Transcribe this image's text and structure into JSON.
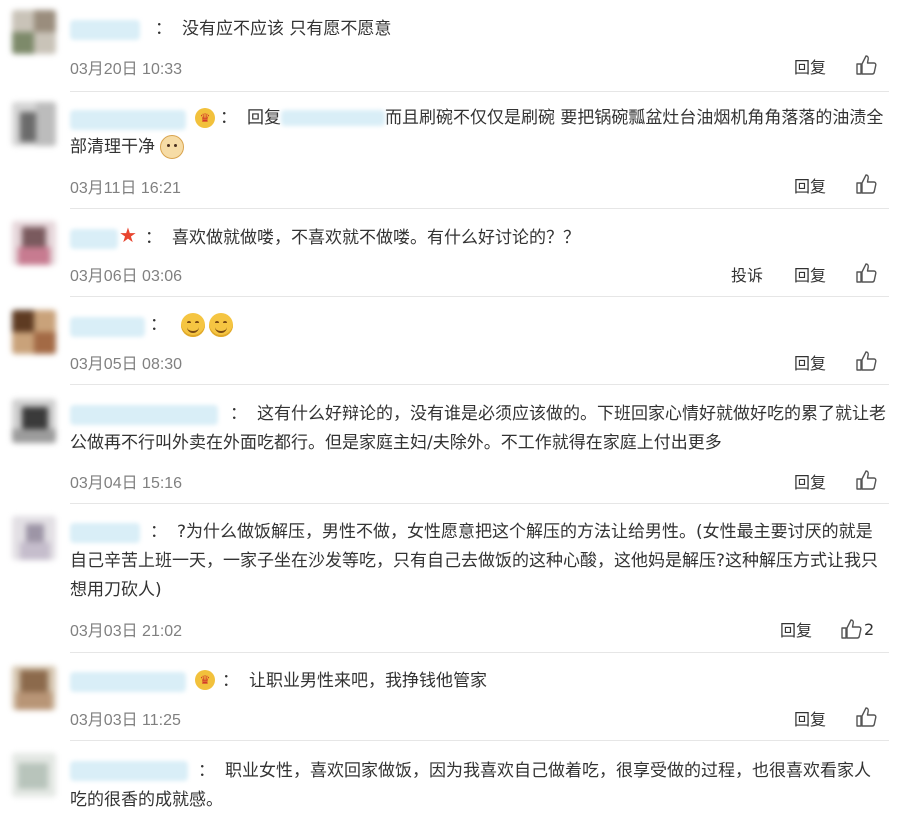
{
  "comments": [
    {
      "text": "没有应不应该 只有愿不愿意",
      "time": "03月20日 10:33",
      "reply_label": "回复"
    },
    {
      "reply_prefix": "回复",
      "text": "而且刷碗不仅仅是刷碗 要把锅碗瓢盆灶台油烟机角角落落的油渍全部清理干净",
      "time": "03月11日 16:21",
      "reply_label": "回复"
    },
    {
      "text": "喜欢做就做喽，不喜欢就不做喽。有什么好讨论的？？",
      "time": "03月06日 03:06",
      "report_label": "投诉",
      "reply_label": "回复"
    },
    {
      "text": "",
      "time": "03月05日 08:30",
      "reply_label": "回复"
    },
    {
      "text": "这有什么好辩论的，没有谁是必须应该做的。下班回家心情好就做好吃的累了就让老公做再不行叫外卖在外面吃都行。但是家庭主妇/夫除外。不工作就得在家庭上付出更多",
      "time": "03月04日 15:16",
      "reply_label": "回复"
    },
    {
      "text": "?为什么做饭解压，男性不做，女性愿意把这个解压的方法让给男性。(女性最主要讨厌的就是自己辛苦上班一天，一家子坐在沙发等吃，只有自己去做饭的这种心酸，这他妈是解压?这种解压方式让我只想用刀砍人)",
      "time": "03月03日 21:02",
      "reply_label": "回复",
      "like_count": "2"
    },
    {
      "text": "让职业男性来吧，我挣钱他管家",
      "time": "03月03日 11:25",
      "reply_label": "回复"
    },
    {
      "text": "职业女性，喜欢回家做饭，因为我喜欢自己做着吃，很享受做的过程，也很喜欢看家人吃的很香的成就感。"
    }
  ],
  "colon": "："
}
